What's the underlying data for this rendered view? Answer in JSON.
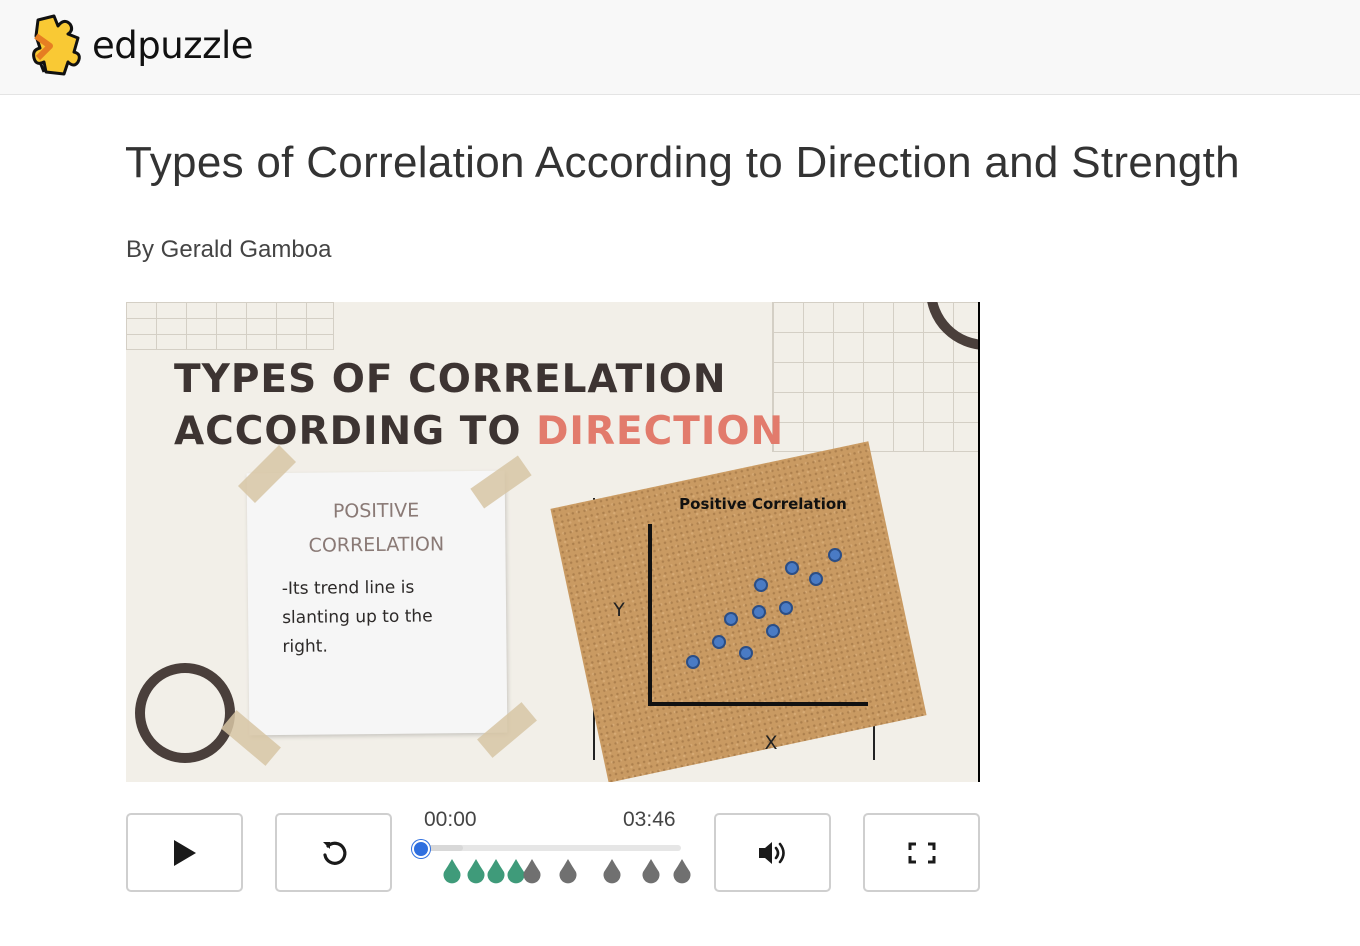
{
  "header": {
    "brand": "edpuzzle",
    "logo_icon": "puzzle-piece-icon",
    "logo_colors": {
      "fill": "#f9c934",
      "outline": "#111111",
      "arrow": "#e67e22"
    }
  },
  "video": {
    "title": "Types of Correlation According to Direction and Strength",
    "author": "By Gerald Gamboa"
  },
  "slide": {
    "title_line1": "TYPES OF CORRELATION",
    "title_line2_prefix": "ACCORDING TO ",
    "title_line2_accent": "DIRECTION",
    "accent_color": "#e27b6c",
    "note_heading_line1": "POSITIVE",
    "note_heading_line2": "CORRELATION",
    "note_body": "-Its trend line is slanting up to the right.",
    "chart_title": "Positive Correlation",
    "axis_y": "Y",
    "axis_x": "X"
  },
  "controls": {
    "play_icon": "play-icon",
    "replay_icon": "replay-icon",
    "volume_icon": "volume-icon",
    "fullscreen_icon": "fullscreen-icon",
    "current_time": "00:00",
    "duration": "03:46",
    "progress_fraction": 0,
    "buffered_fraction": 0.16,
    "handle_color": "#2f6fdf",
    "markers": [
      {
        "state": "answered",
        "color": "#3f9b7a"
      },
      {
        "state": "answered",
        "color": "#3f9b7a"
      },
      {
        "state": "answered",
        "color": "#3f9b7a"
      },
      {
        "state": "answered",
        "color": "#3f9b7a"
      },
      {
        "state": "pending",
        "color": "#707070"
      },
      {
        "state": "pending",
        "color": "#707070"
      },
      {
        "state": "pending",
        "color": "#707070"
      },
      {
        "state": "pending",
        "color": "#707070"
      },
      {
        "state": "pending",
        "color": "#707070"
      }
    ]
  }
}
